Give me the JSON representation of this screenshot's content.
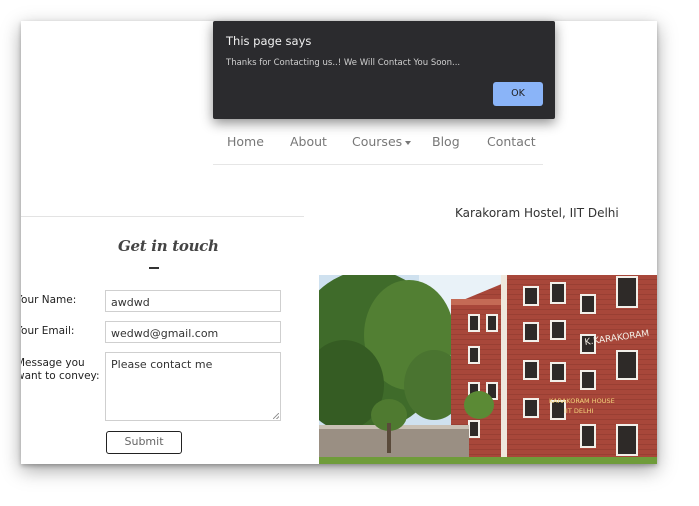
{
  "dialog": {
    "title": "This page says",
    "message": "Thanks for Contacting us..! We Will Contact You Soon...",
    "ok_label": "OK"
  },
  "nav": {
    "items": [
      {
        "label": "Home"
      },
      {
        "label": "About"
      },
      {
        "label": "Courses"
      },
      {
        "label": "Blog"
      },
      {
        "label": "Contact"
      }
    ]
  },
  "hostel_caption": "Karakoram Hostel, IIT Delhi",
  "form": {
    "heading": "Get in touch",
    "name_label": "Your Name:",
    "name_value": "awdwd",
    "email_label": "Your Email:",
    "email_value": "wedwd@gmail.com",
    "message_label_line1": "Message you",
    "message_label_line2": "want to convey:",
    "message_value": "Please contact me",
    "submit_label": "Submit"
  },
  "photo": {
    "sign_text": "K.KARAKORAM",
    "plaque_line1": "KARAKORAM HOUSE",
    "plaque_line2": "IIT DELHI"
  },
  "colors": {
    "dialog_bg": "#2b2b2e",
    "ok_button": "#8ab4f8",
    "brick": "#a8473a"
  }
}
